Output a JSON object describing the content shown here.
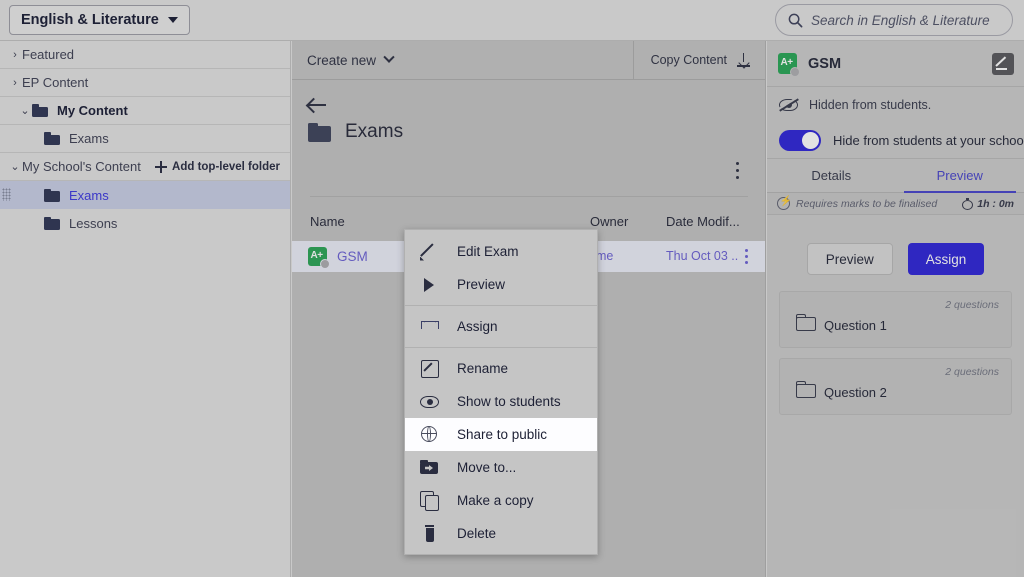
{
  "topbar": {
    "subject_label": "English & Literature",
    "subject_caret_icon": "chevron-down-icon",
    "search_placeholder": "Search in English & Literature",
    "search_icon": "search-icon"
  },
  "sidebar": {
    "items": [
      {
        "label": "Featured",
        "chevron": "›",
        "type": "collapsed"
      },
      {
        "label": "EP Content",
        "chevron": "›",
        "type": "collapsed"
      },
      {
        "label": "My Content",
        "chevron": "⌄",
        "type": "expanded-folder"
      },
      {
        "label": "Exams",
        "type": "child-folder"
      },
      {
        "label": "My School's Content",
        "chevron": "⌄",
        "type": "expanded-group"
      },
      {
        "label": "Exams",
        "type": "child-folder-selected"
      },
      {
        "label": "Lessons",
        "type": "child-folder"
      }
    ],
    "add_top_level_label": "Add top-level folder",
    "add_icon": "plus-icon",
    "drag_handle_icon": "drag-handle-icon",
    "selected_index": 5
  },
  "main": {
    "toolbar": {
      "create_new_label": "Create new",
      "create_new_icon": "chevron-down-icon",
      "copy_content_label": "Copy Content",
      "copy_content_icon": "download-icon"
    },
    "back_icon": "back-arrow-icon",
    "folder_icon": "folder-icon",
    "folder_title": "Exams",
    "folder_menu_icon": "kebab-menu-icon",
    "columns": [
      "Name",
      "Owner",
      "Date Modif..."
    ],
    "rows": [
      {
        "icon": "exam-file-icon",
        "icon_text": "A+",
        "name": "GSM",
        "owner": "me",
        "date_modified": "Thu Oct 03 ..",
        "row_menu_icon": "kebab-menu-icon"
      }
    ]
  },
  "context_menu": {
    "groups": [
      [
        {
          "label": "Edit Exam",
          "icon": "pencil-icon",
          "highlighted": false
        },
        {
          "label": "Preview",
          "icon": "play-icon",
          "highlighted": false
        }
      ],
      [
        {
          "label": "Assign",
          "icon": "send-icon",
          "highlighted": false
        }
      ],
      [
        {
          "label": "Rename",
          "icon": "rename-icon",
          "highlighted": false
        },
        {
          "label": "Show to students",
          "icon": "eye-icon",
          "highlighted": false
        },
        {
          "label": "Share to public",
          "icon": "globe-icon",
          "highlighted": true
        },
        {
          "label": "Move to...",
          "icon": "move-folder-icon",
          "highlighted": false
        },
        {
          "label": "Make a copy",
          "icon": "copy-icon",
          "highlighted": false
        },
        {
          "label": "Delete",
          "icon": "trash-icon",
          "highlighted": false
        }
      ]
    ]
  },
  "right_panel": {
    "icon": "exam-file-icon",
    "icon_text": "A+",
    "title": "GSM",
    "edit_icon": "edit-pencil-icon",
    "hidden_note": "Hidden from students.",
    "hidden_note_icon": "eye-slash-icon",
    "toggle_label": "Hide from students at your school",
    "toggle_on": true,
    "toggle_color": "#2016D6",
    "tabs": [
      {
        "label": "Details",
        "active": false
      },
      {
        "label": "Preview",
        "active": true
      }
    ],
    "requires_marks_text": "Requires marks to be finalised",
    "requires_marks_icon": "bolt-circle-icon",
    "duration": "1h : 0m",
    "duration_icon": "timer-icon",
    "buttons": [
      {
        "label": "Preview",
        "style": "secondary"
      },
      {
        "label": "Assign",
        "style": "primary"
      }
    ],
    "questions": [
      {
        "label": "Question 1",
        "count": "2 questions",
        "icon": "folder-outline-icon"
      },
      {
        "label": "Question 2",
        "count": "2 questions",
        "icon": "folder-outline-icon"
      }
    ]
  }
}
